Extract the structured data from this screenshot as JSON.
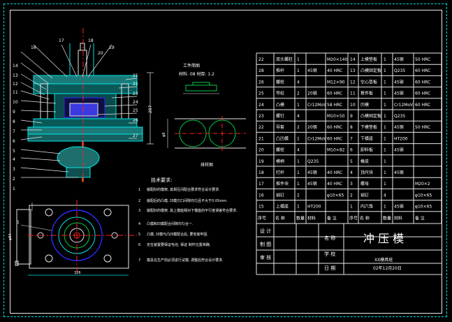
{
  "colors": {
    "background": "#000000",
    "line": "#e8e8e8",
    "cyan": "#00e5e5",
    "green": "#00cc44",
    "red": "#ff2020",
    "blue": "#2a2aff",
    "yellow": "#e6e600",
    "magenta": "#ff00ff"
  },
  "assembly_callouts_left": [
    "14",
    "13",
    "12",
    "11",
    "10",
    "9",
    "8",
    "7",
    "6",
    "5",
    "4",
    "3",
    "2",
    "1"
  ],
  "assembly_callouts_top": [
    "16",
    "17",
    "18",
    "19",
    "20"
  ],
  "assembly_callouts_right": [
    "21",
    "22",
    "23",
    "24",
    "25",
    "26",
    "27"
  ],
  "assembly_height_dim": "207",
  "part_drawing": {
    "title": "工件简图",
    "material": "材料: 08  材厚: 1.2"
  },
  "layout_label": "排样图",
  "strip_width_dim": "φ8",
  "plan_dims": {
    "left": "φ84",
    "bottom": "326",
    "callout": "1"
  },
  "requirements": {
    "title": "技术要求:",
    "items": [
      {
        "n": "1",
        "text": "装配好的模架, 其相互间配合要求符合设计要求."
      },
      {
        "n": "2",
        "text": "装配后的凸模, 凹模刃口间隙均匀且不大于0.05mm."
      },
      {
        "n": "3",
        "text": "装配好的模架, 其上模座相对下模座的平行度误差符合要求."
      },
      {
        "n": "4",
        "text": "凸模和凹模配合间隙均匀合一."
      },
      {
        "n": "5",
        "text": "凸模, 凹模与凸凹模配合后, 要安装牢固."
      },
      {
        "n": "6",
        "text": "定位装置要保证毛坯, 保证 制件位置准确."
      },
      {
        "n": "7",
        "text": "模具在生产前必须进行试模, 调整后符合设计要求."
      }
    ]
  },
  "bom_left": [
    [
      "22",
      "双头螺柱",
      "1",
      "",
      "M20×140"
    ],
    [
      "28",
      "推杆",
      "1",
      "45钢",
      "40 HRC"
    ],
    [
      "26",
      "螺栓",
      "4",
      "",
      "M12×90"
    ],
    [
      "25",
      "导柱",
      "2",
      "20钢",
      "60 HRC"
    ],
    [
      "24",
      "凸模",
      "1",
      "Cr12MoV",
      "58 HRC"
    ],
    [
      "23",
      "螺钉",
      "4",
      "",
      "M10×50"
    ],
    [
      "22",
      "导套",
      "2",
      "20钢",
      "60 HRC"
    ],
    [
      "21",
      "凸凹模",
      "1",
      "Cr12MoV",
      "60 HRC"
    ],
    [
      "20",
      "螺栓",
      "4",
      "",
      "M10×82"
    ],
    [
      "19",
      "模柄",
      "1",
      "Q235",
      ""
    ],
    [
      "18",
      "打杆",
      "1",
      "45钢",
      "40 HRC"
    ],
    [
      "17",
      "推件块",
      "1",
      "45钢",
      "40 HRC"
    ],
    [
      "16",
      "销钉",
      "2",
      "",
      "φ10×65"
    ],
    [
      "15",
      "上模座",
      "1",
      "HT200",
      ""
    ]
  ],
  "bom_right": [
    [
      "14",
      "上模垫板",
      "1",
      "45钢",
      "50 HRC"
    ],
    [
      "13",
      "凸模固定板",
      "1",
      "Q235",
      "60 HRC"
    ],
    [
      "12",
      "空心垫板",
      "1",
      "45钢",
      "60 HRC"
    ],
    [
      "11",
      "推件板",
      "1",
      "45钢",
      "60 HRC"
    ],
    [
      "10",
      "凹模",
      "1",
      "Cr12MoV",
      "60 HRC"
    ],
    [
      "9",
      "凸模固定板",
      "1",
      "Q235",
      ""
    ],
    [
      "8",
      "下模垫板",
      "1",
      "45钢",
      "50 HRC"
    ],
    [
      "7",
      "下模座",
      "1",
      "HT200",
      ""
    ],
    [
      "6",
      "卸料板",
      "1",
      "45钢",
      ""
    ],
    [
      "5",
      "橡皮",
      "1",
      "",
      ""
    ],
    [
      "4",
      "顶尺块",
      "1",
      "45钢",
      ""
    ],
    [
      "3",
      "螺母",
      "1",
      "",
      "M20×2"
    ],
    [
      "2",
      "销钉",
      "4",
      "",
      "φ10×65"
    ],
    [
      "1",
      "内六角",
      "1",
      "45钢",
      "φ10×65"
    ]
  ],
  "bom_header": [
    "序号",
    "名 称",
    "数量",
    "材料",
    "备 注"
  ],
  "title_block": {
    "design": "设 计",
    "drawing": "制 图",
    "review": "审 核",
    "name_label": "名 称",
    "name": "冲 压 模",
    "school_label": "学 校",
    "school": "XX模具班",
    "date_label": "日 期",
    "date": "02年12月20日"
  }
}
